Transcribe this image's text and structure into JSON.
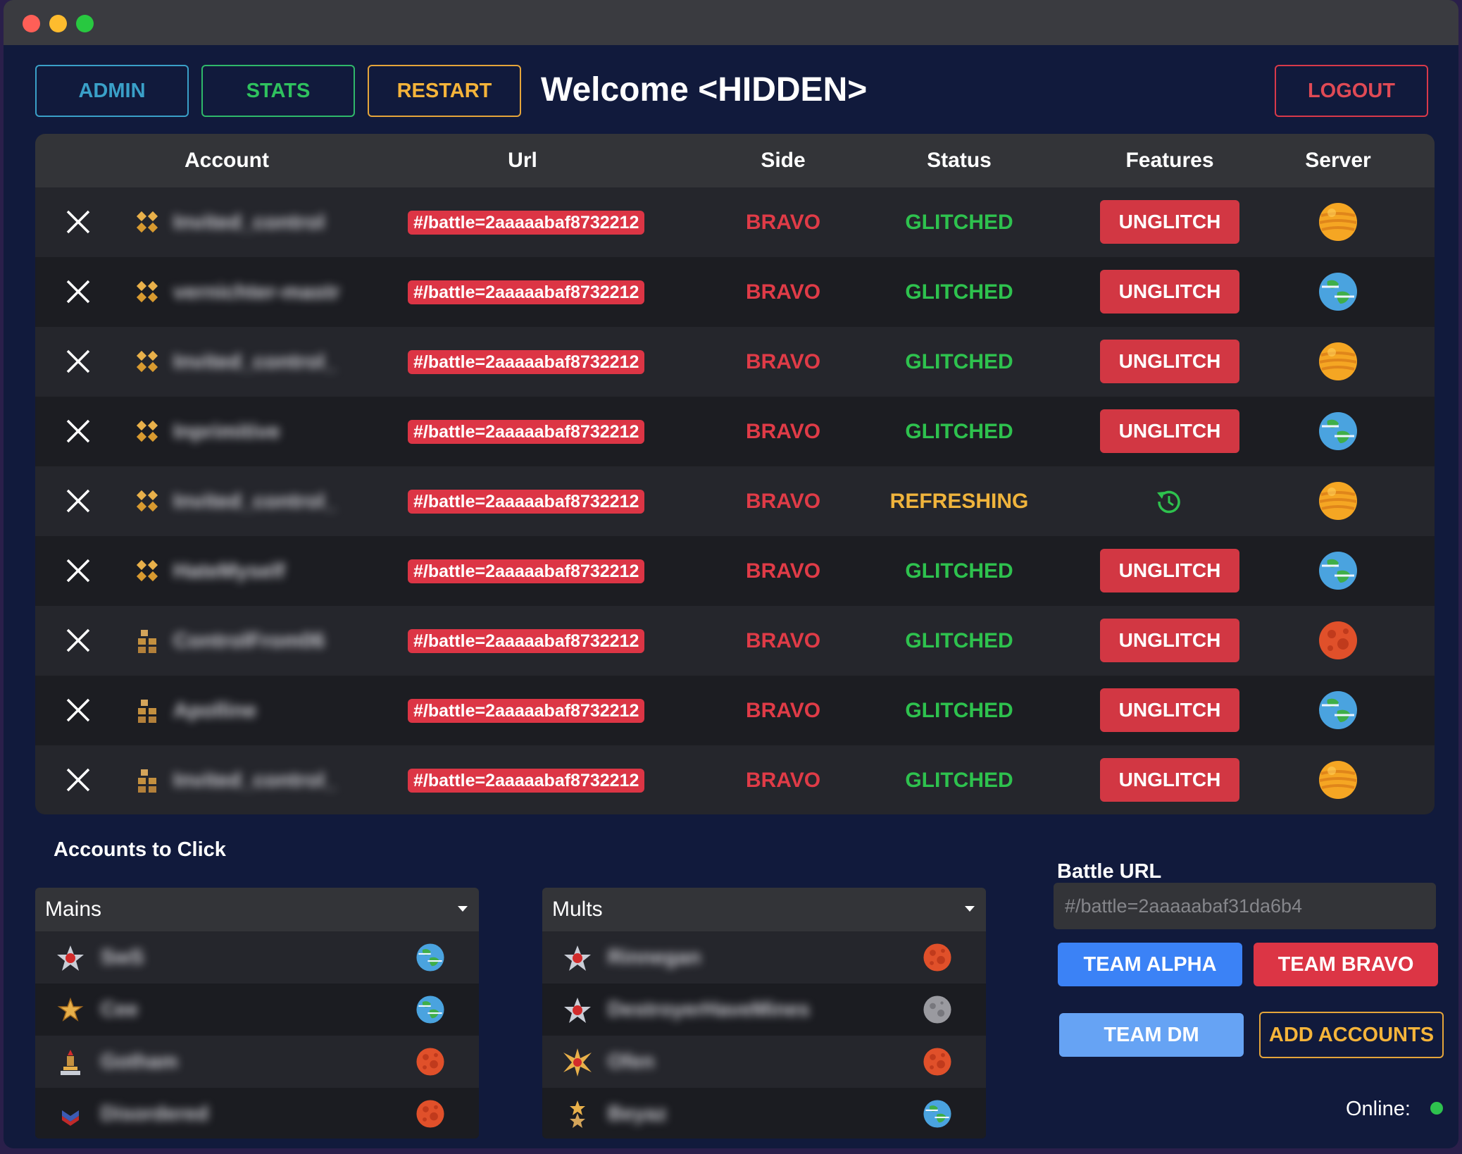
{
  "window": {
    "controls": [
      "close",
      "minimize",
      "maximize"
    ]
  },
  "header": {
    "admin_label": "ADMIN",
    "stats_label": "STATS",
    "restart_label": "RESTART",
    "welcome": "Welcome <HIDDEN>",
    "logout_label": "LOGOUT"
  },
  "table": {
    "columns": [
      "Account",
      "Url",
      "Side",
      "Status",
      "Features",
      "Server"
    ],
    "rows": [
      {
        "account": "Invited_control",
        "rank_icon": "gold-rank-icon",
        "url": "#/battle=2aaaaabaf8732212",
        "side": "BRAVO",
        "status": "GLITCHED",
        "feature": "UNGLITCH",
        "server": "sun"
      },
      {
        "account": "vernichter-mastr",
        "rank_icon": "gold-rank-icon",
        "url": "#/battle=2aaaaabaf8732212",
        "side": "BRAVO",
        "status": "GLITCHED",
        "feature": "UNGLITCH",
        "server": "earth"
      },
      {
        "account": "Invited_control_",
        "rank_icon": "gold-rank-icon",
        "url": "#/battle=2aaaaabaf8732212",
        "side": "BRAVO",
        "status": "GLITCHED",
        "feature": "UNGLITCH",
        "server": "sun"
      },
      {
        "account": "Inprimitive",
        "rank_icon": "gold-rank-icon",
        "url": "#/battle=2aaaaabaf8732212",
        "side": "BRAVO",
        "status": "GLITCHED",
        "feature": "UNGLITCH",
        "server": "earth"
      },
      {
        "account": "Invited_control_",
        "rank_icon": "gold-rank-icon",
        "url": "#/battle=2aaaaabaf8732212",
        "side": "BRAVO",
        "status": "REFRESHING",
        "feature": "",
        "server": "sun"
      },
      {
        "account": "HateMyself",
        "rank_icon": "gold-rank-icon",
        "url": "#/battle=2aaaaabaf8732212",
        "side": "BRAVO",
        "status": "GLITCHED",
        "feature": "UNGLITCH",
        "server": "earth"
      },
      {
        "account": "ControlFrom06",
        "rank_icon": "bronze-rank-icon",
        "url": "#/battle=2aaaaabaf8732212",
        "side": "BRAVO",
        "status": "GLITCHED",
        "feature": "UNGLITCH",
        "server": "mars"
      },
      {
        "account": "Apolline",
        "rank_icon": "bronze-rank-icon",
        "url": "#/battle=2aaaaabaf8732212",
        "side": "BRAVO",
        "status": "GLITCHED",
        "feature": "UNGLITCH",
        "server": "earth"
      },
      {
        "account": "Invited_control_",
        "rank_icon": "bronze-rank-icon",
        "url": "#/battle=2aaaaabaf8732212",
        "side": "BRAVO",
        "status": "GLITCHED",
        "feature": "UNGLITCH",
        "server": "sun"
      }
    ]
  },
  "accounts_to_click": {
    "title": "Accounts to Click",
    "mains": {
      "label": "Mains",
      "items": [
        {
          "name": "SwS",
          "rank_icon": "red-star-rank-icon",
          "server": "earth"
        },
        {
          "name": "Cee",
          "rank_icon": "gold-star-rank-icon",
          "server": "earth"
        },
        {
          "name": "Gotham",
          "rank_icon": "trophy-rank-icon",
          "server": "mars"
        },
        {
          "name": "Disordered",
          "rank_icon": "chevron-rank-icon",
          "server": "mars"
        }
      ]
    },
    "mults": {
      "label": "Mults",
      "items": [
        {
          "name": "Rinnegan",
          "rank_icon": "red-star-rank-icon",
          "server": "mars"
        },
        {
          "name": "DestroyerHaveMines",
          "rank_icon": "red-star-rank-icon",
          "server": "moon"
        },
        {
          "name": "Ofen",
          "rank_icon": "starburst-rank-icon",
          "server": "mars"
        },
        {
          "name": "Beyaz",
          "rank_icon": "double-star-rank-icon",
          "server": "earth"
        }
      ]
    }
  },
  "battle": {
    "label": "Battle URL",
    "placeholder": "#/battle=2aaaaabaf31da6b4",
    "team_alpha": "TEAM ALPHA",
    "team_bravo": "TEAM BRAVO",
    "team_dm": "TEAM DM",
    "add_accounts": "ADD ACCOUNTS"
  },
  "online": {
    "label": "Online:",
    "color": "#2ec24e"
  },
  "colors": {
    "background": "#111a3c",
    "danger": "#dc3545",
    "success": "#2ec24e",
    "warning": "#f0b43c",
    "primary": "#3b82f6"
  }
}
